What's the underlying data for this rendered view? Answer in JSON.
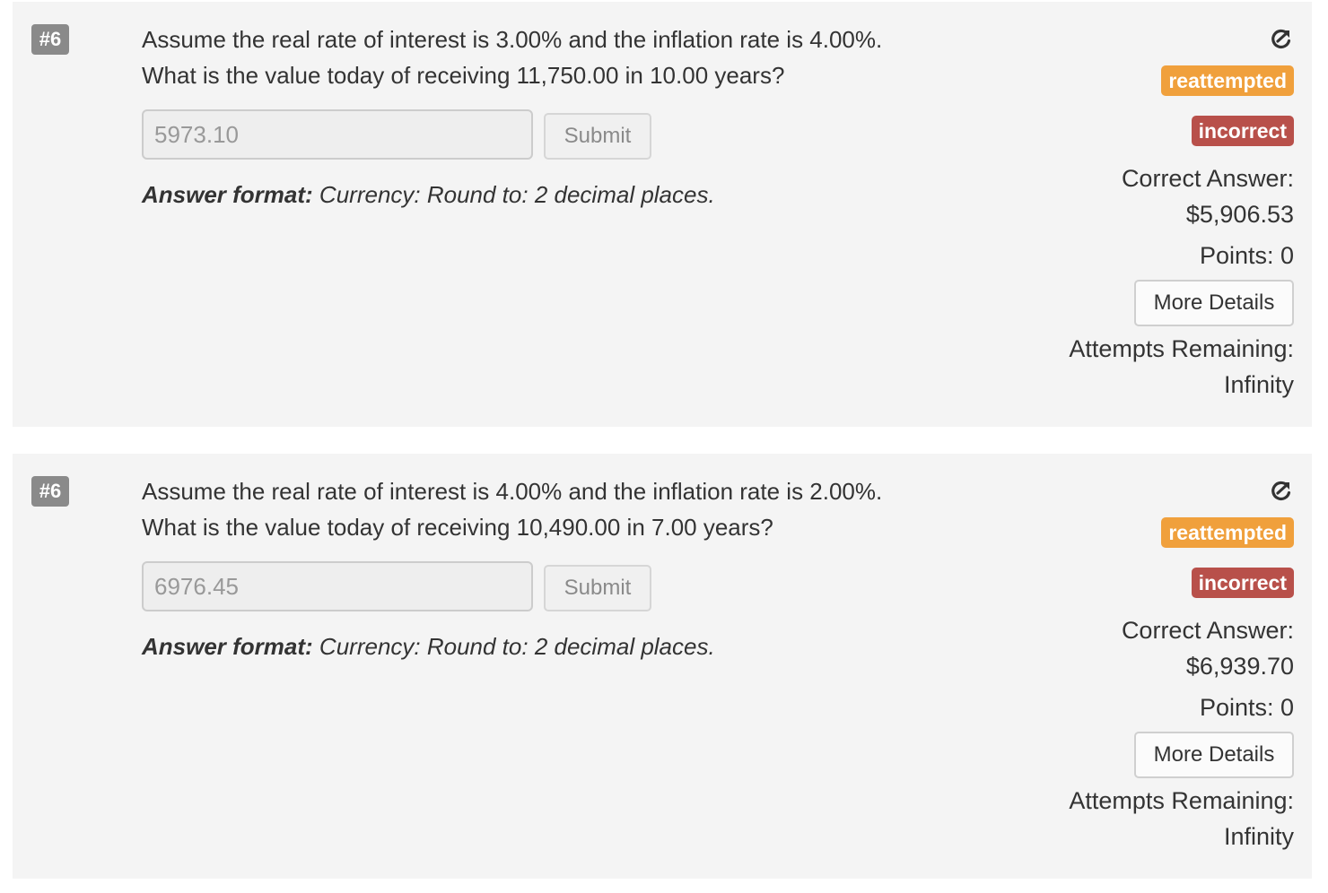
{
  "questions": [
    {
      "number": "#6",
      "text_line1": "Assume the real rate of interest is 3.00% and the inflation rate is 4.00%.",
      "text_line2": "What is the value today of receiving 11,750.00 in 10.00 years?",
      "answer_value": "5973.10",
      "submit_label": "Submit",
      "format_label": "Answer format:",
      "format_text": " Currency: Round to: 2 decimal places.",
      "share_icon": "share-icon",
      "status_reattempted": "reattempted",
      "status_incorrect": "incorrect",
      "correct_answer_label": "Correct Answer:",
      "correct_answer_value": "$5,906.53",
      "points": "Points: 0",
      "more_details_label": "More Details",
      "attempts_label": "Attempts Remaining:",
      "attempts_value": "Infinity"
    },
    {
      "number": "#6",
      "text_line1": "Assume the real rate of interest is 4.00% and the inflation rate is 2.00%.",
      "text_line2": "What is the value today of receiving 10,490.00 in 7.00 years?",
      "answer_value": "6976.45",
      "submit_label": "Submit",
      "format_label": "Answer format:",
      "format_text": " Currency: Round to: 2 decimal places.",
      "share_icon": "share-icon",
      "status_reattempted": "reattempted",
      "status_incorrect": "incorrect",
      "correct_answer_label": "Correct Answer:",
      "correct_answer_value": "$6,939.70",
      "points": "Points: 0",
      "more_details_label": "More Details",
      "attempts_label": "Attempts Remaining:",
      "attempts_value": "Infinity"
    }
  ],
  "colors": {
    "card_bg": "#f4f4f4",
    "badge_number": "#8a8a8a",
    "reattempted": "#f0a03c",
    "incorrect": "#b8504a"
  }
}
